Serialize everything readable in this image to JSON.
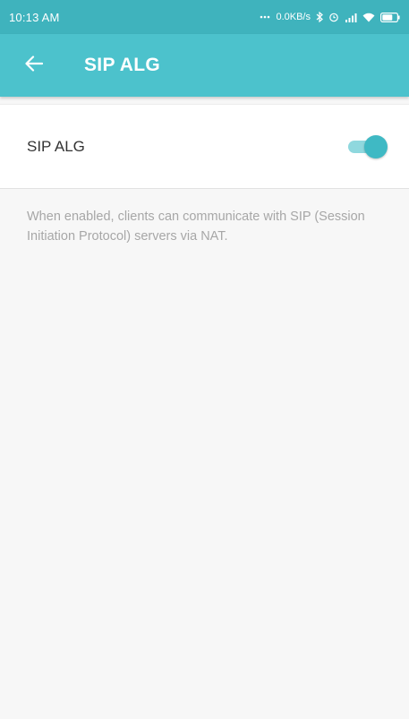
{
  "status_bar": {
    "time": "10:13 AM",
    "network_speed": "0.0KB/s",
    "icons": [
      "more-dots-icon",
      "bluetooth-icon",
      "alarm-icon",
      "signal-icon",
      "wifi-icon",
      "battery-icon"
    ]
  },
  "app_bar": {
    "back_icon": "arrow-left-icon",
    "title": "SIP ALG"
  },
  "setting": {
    "label": "SIP ALG",
    "enabled": true
  },
  "description": "When enabled, clients can communicate with SIP (Session Initiation Protocol) servers via NAT.",
  "colors": {
    "status_bar": "#3fb3bd",
    "app_bar": "#4cc2cc",
    "toggle_accent": "#3fb9c4",
    "background": "#f7f7f7"
  }
}
